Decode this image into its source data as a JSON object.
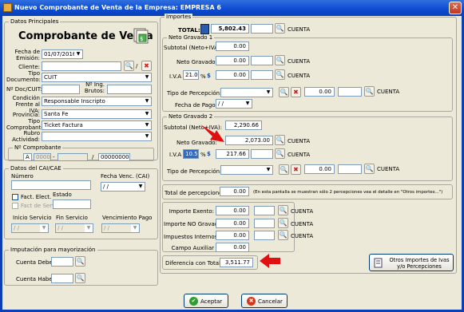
{
  "window": {
    "title": "Nuevo Comprobante de Venta de la Empresa: EMPRESA 6",
    "close": "✕"
  },
  "datos_principales": {
    "legend": "Datos Principales",
    "heading": "Comprobante de Venta",
    "fecha_label": "Fecha de Emisión:",
    "fecha_value": "01/07/2016",
    "cliente_label": "Cliente:",
    "cliente_value": "",
    "slash": "/",
    "tipo_doc_label": "Tipo Documento:",
    "tipo_doc_value": "CUIT",
    "nro_doc_label": "Nº Doc/CUIT:",
    "nro_doc_value": "",
    "ing_brutos_label": "Nº Ing. Brutos:",
    "ing_brutos_value": "",
    "condicion_label": "Condición Frente al IVA:",
    "condicion_value": "Responsable Inscripto",
    "provincia_label": "Provincia:",
    "provincia_value": "Santa Fe",
    "tipo_comp_label": "Tipo Comprobante:",
    "tipo_comp_value": "Ticket Factura",
    "rubro_label": "Rubro Actividad:",
    "rubro_value": "",
    "nro_comp_label": "Nº Comprobante",
    "nro_letra": "A",
    "nro_pv": "0000",
    "nro_sep": "-",
    "nro_num": "00000000"
  },
  "cai": {
    "legend": "Datos del CAI/CAE",
    "numero_label": "Número",
    "numero_value": "",
    "fecha_venc_label": "Fecha Venc. (CAI)",
    "fecha_venc_value": "/ /",
    "fact_elect_label": "Fact. Elect.",
    "fact_serv_label": "Fact de Serv.",
    "estado_label": "Estado",
    "estado_value": "",
    "inicio_label": "Inicio Servicio",
    "inicio_value": "/ /",
    "fin_label": "Fin Servicio",
    "fin_value": "/ /",
    "venc_pago_label": "Vencimiento Pago",
    "venc_pago_value": "/ /"
  },
  "imputacion": {
    "legend": "Imputación para mayorización",
    "debe_label": "Cuenta Debe:",
    "debe_value": "",
    "haber_label": "Cuenta Haber:",
    "haber_value": ""
  },
  "importes": {
    "legend": "Importes",
    "total_label": "TOTAL:",
    "total_value": "5,802.43",
    "total_cuenta_value": "",
    "cuenta_label": "CUENTA"
  },
  "neto1": {
    "legend": "Neto Gravado 1",
    "subtotal_label": "Subtotal (Neto+IVA):",
    "subtotal_value": "0.00",
    "neto_label": "Neto Gravado:",
    "neto_value": "0.00",
    "iva_label": "I.V.A",
    "iva_rate": "21.00",
    "pct": "%",
    "dollar": "$",
    "iva_value": "0.00",
    "tipo_perc_label": "Tipo de Percepción:",
    "perc_value": "0.00",
    "fecha_pago_label": "Fecha de Pago:",
    "fecha_pago_value": "/ /"
  },
  "neto2": {
    "legend": "Neto Gravado 2",
    "subtotal_label": "Subtotal (Neto+IVA):",
    "subtotal_value": "2,290.66",
    "neto_label": "Neto Gravado:",
    "neto_value": "2,073.00",
    "iva_label": "I.V.A",
    "iva_rate": "10.50",
    "pct": "%",
    "dollar": "$",
    "iva_value": "217.66",
    "tipo_perc_label": "Tipo de Percepción:",
    "perc_value": "0.00"
  },
  "percepciones": {
    "total_label": "Total de percepciones",
    "total_value": "0.00",
    "note": "(En esta pantalla se muestran sólo 2 percepciones vea el detalle en \"Otros importes...\")"
  },
  "otros": {
    "exento_label": "Importe Exento:",
    "exento_value": "0.00",
    "no_gravado_label": "Importe NO Gravado:",
    "no_gravado_value": "0.00",
    "internos_label": "Impuestos Internos:",
    "internos_value": "0.00",
    "auxiliar_label": "Campo Auxiliar",
    "auxiliar_value": "0.00"
  },
  "diferencia": {
    "label": "Diferencia con Total",
    "value": "3,511.77"
  },
  "otros_btn": "Otros Importes de Ivas y/o Percepciones",
  "actions": {
    "accept": "Aceptar",
    "cancel": "Cancelar"
  },
  "colors": {
    "arrow": "#e01010",
    "titlebar": "#0b4ad0"
  }
}
